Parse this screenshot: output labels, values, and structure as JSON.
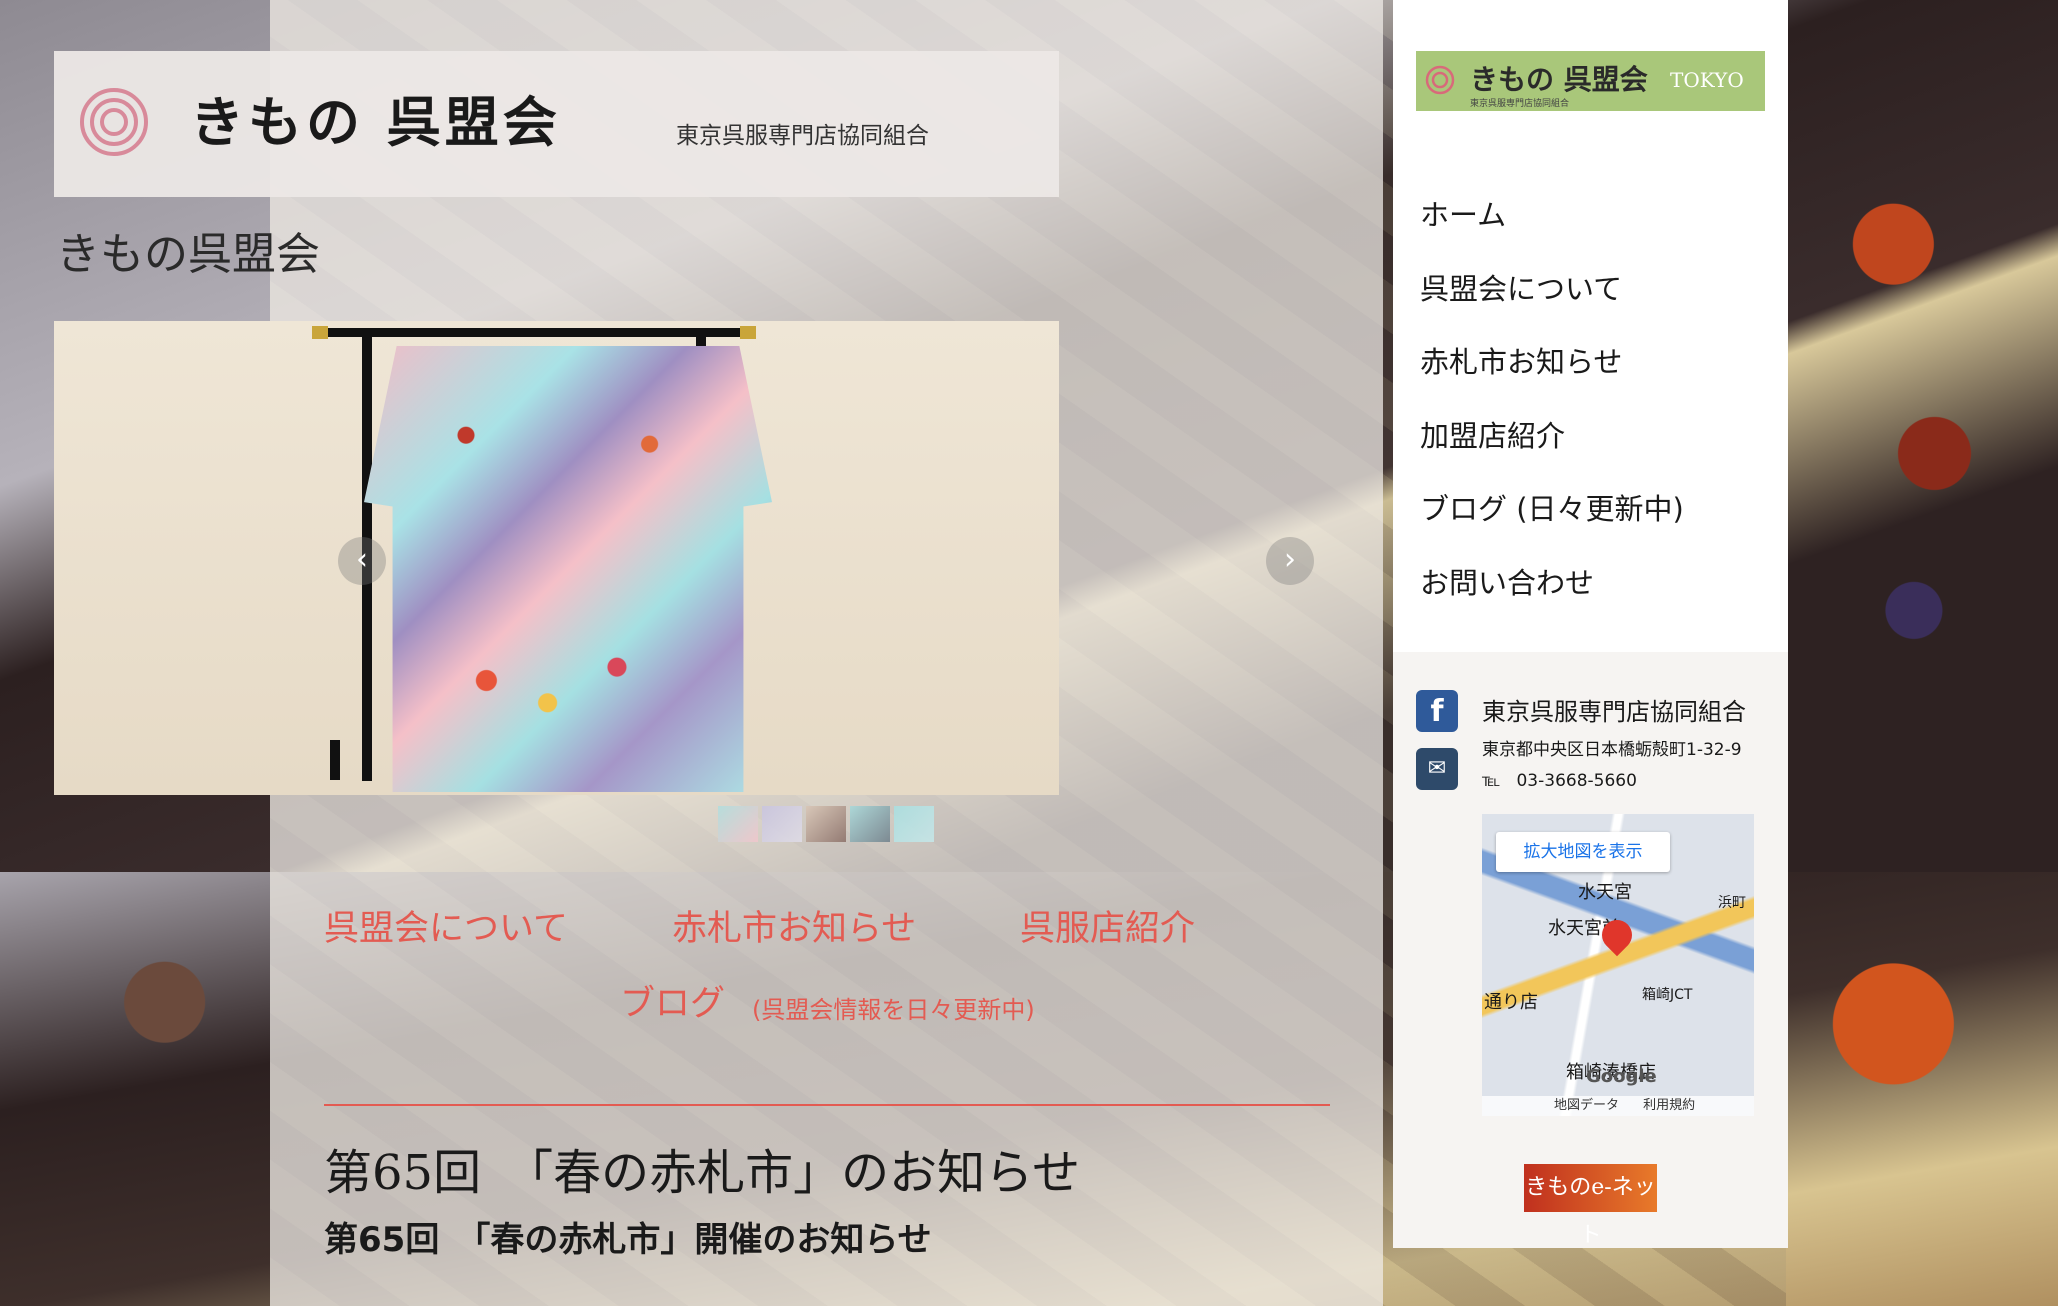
{
  "header": {
    "logo_text": "きもの 呉盟会",
    "logo_subtitle": "東京呉服専門店協同組合",
    "site_title": "きもの呉盟会"
  },
  "slider": {
    "prev_icon": "chevron-left-icon",
    "next_icon": "chevron-right-icon",
    "prev_glyph": "‹",
    "next_glyph": "›",
    "thumbnail_count": 5
  },
  "links": {
    "about": "呉盟会について",
    "akafuda": "赤札市お知らせ",
    "stores": "呉服店紹介",
    "blog": "ブログ",
    "blog_note": "(呉盟会情報を日々更新中)"
  },
  "news": {
    "title": "第65回　「春の赤札市」のお知らせ",
    "subtitle": "第65回　「春の赤札市」開催のお知らせ"
  },
  "sidebar": {
    "logo_text": "きもの 呉盟会",
    "logo_tokyo": "TOKYO",
    "logo_sub": "東京呉服専門店協同組合",
    "nav": [
      {
        "label": "ホーム"
      },
      {
        "label": "呉盟会について"
      },
      {
        "label": "赤札市お知らせ"
      },
      {
        "label": "加盟店紹介"
      },
      {
        "label": "ブログ (日々更新中)"
      },
      {
        "label": "お問い合わせ"
      }
    ],
    "org_name": "東京呉服専門店協同組合",
    "address": "東京都中央区日本橋蛎殻町1-32-9",
    "tel_label": "℡",
    "tel": "03-3668-5660",
    "map": {
      "expand_label": "拡大地図を表示",
      "labels": [
        "水天宮",
        "水天宮前",
        "浜町",
        "箱崎JCT",
        "通り店",
        "箱崎湊橋店"
      ],
      "google": "Google",
      "footer_data": "地図データ",
      "footer_terms": "利用規約"
    },
    "banner_text": "きものe-ネット"
  },
  "colors": {
    "accent_red": "#e35b52",
    "facebook_blue": "#2f5a9a",
    "mail_navy": "#2e4a6a",
    "logo_green": "#a9c77a"
  }
}
